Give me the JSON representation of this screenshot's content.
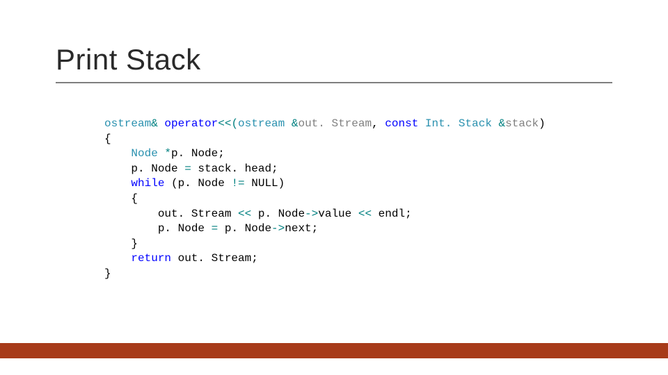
{
  "title": "Print Stack",
  "code": {
    "tokens": [
      [
        [
          "t-type",
          "ostream"
        ],
        [
          "t-op",
          "& "
        ],
        [
          "t-kw",
          "operator"
        ],
        [
          "t-op",
          "<<("
        ],
        [
          "t-type",
          "ostream "
        ],
        [
          "t-op",
          "&"
        ],
        [
          "t-param",
          "out. Stream"
        ],
        [
          "t-id",
          ", "
        ],
        [
          "t-kw",
          "const "
        ],
        [
          "t-type",
          "Int. Stack "
        ],
        [
          "t-op",
          "&"
        ],
        [
          "t-param",
          "stack"
        ],
        [
          "t-id",
          ")"
        ]
      ],
      [
        [
          "t-id",
          "{"
        ]
      ],
      [
        [
          "t-id",
          "    "
        ],
        [
          "t-type",
          "Node "
        ],
        [
          "t-op",
          "*"
        ],
        [
          "t-id",
          "p. Node;"
        ]
      ],
      [
        [
          "t-id",
          "    p. Node "
        ],
        [
          "t-op",
          "="
        ],
        [
          "t-id",
          " stack. head;"
        ]
      ],
      [
        [
          "t-id",
          "    "
        ],
        [
          "t-kw",
          "while"
        ],
        [
          "t-id",
          " (p. Node "
        ],
        [
          "t-op",
          "!="
        ],
        [
          "t-id",
          " NULL)"
        ]
      ],
      [
        [
          "t-id",
          "    {"
        ]
      ],
      [
        [
          "t-id",
          "        out. Stream "
        ],
        [
          "t-op",
          "<<"
        ],
        [
          "t-id",
          " p. Node"
        ],
        [
          "t-op",
          "->"
        ],
        [
          "t-id",
          "value "
        ],
        [
          "t-op",
          "<<"
        ],
        [
          "t-id",
          " endl;"
        ]
      ],
      [
        [
          "t-id",
          "        p. Node "
        ],
        [
          "t-op",
          "="
        ],
        [
          "t-id",
          " p. Node"
        ],
        [
          "t-op",
          "->"
        ],
        [
          "t-id",
          "next;"
        ]
      ],
      [
        [
          "t-id",
          "    }"
        ]
      ],
      [
        [
          "t-id",
          "    "
        ],
        [
          "t-kw",
          "return"
        ],
        [
          "t-id",
          " out. Stream;"
        ]
      ],
      [
        [
          "t-id",
          "}"
        ]
      ]
    ]
  },
  "colors": {
    "accent_bar": "#a73b1a",
    "underline": "#7f7f7f"
  }
}
